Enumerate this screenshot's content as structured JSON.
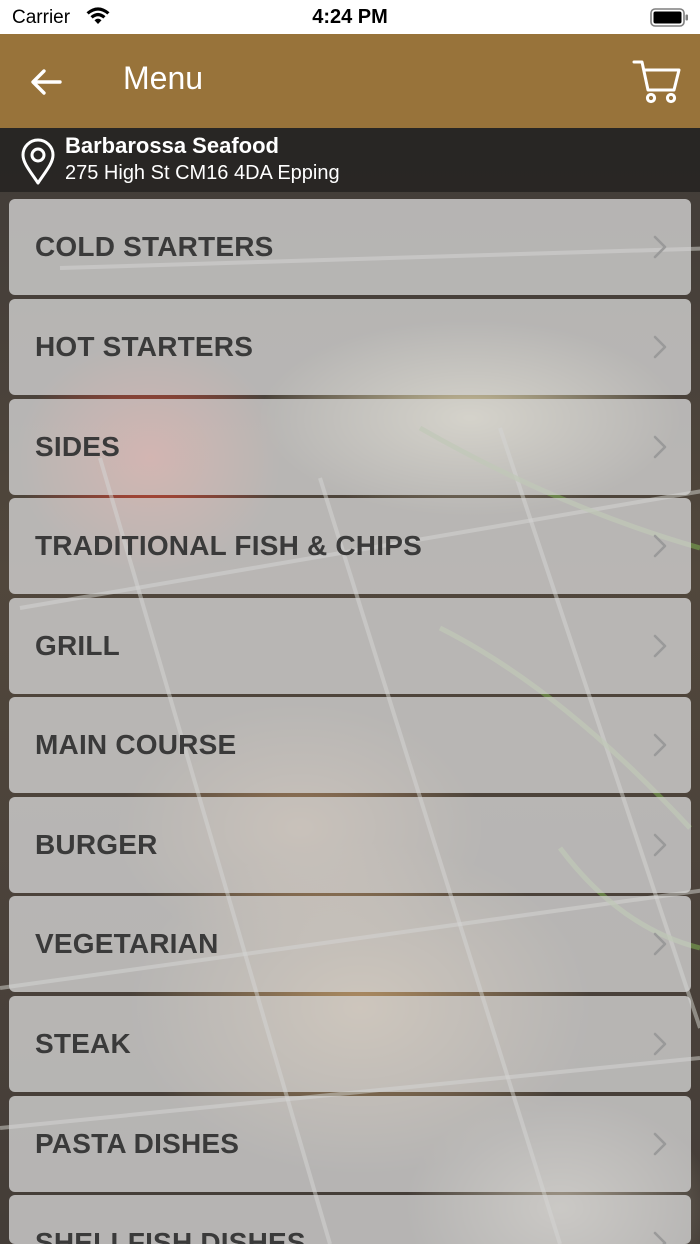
{
  "status_bar": {
    "carrier": "Carrier",
    "time": "4:24 PM"
  },
  "navbar": {
    "title": "Menu",
    "back_icon": "arrow-left-icon",
    "cart_icon": "cart-icon",
    "background_color": "#98733a"
  },
  "location": {
    "name": "Barbarossa Seafood",
    "address": "275 High St CM16 4DA Epping",
    "icon": "location-pin-icon"
  },
  "menu": {
    "items": [
      {
        "label": "COLD STARTERS"
      },
      {
        "label": "HOT STARTERS"
      },
      {
        "label": "SIDES"
      },
      {
        "label": "TRADITIONAL FISH & CHIPS"
      },
      {
        "label": "GRILL"
      },
      {
        "label": "MAIN COURSE"
      },
      {
        "label": "BURGER"
      },
      {
        "label": "VEGETARIAN"
      },
      {
        "label": "STEAK"
      },
      {
        "label": "PASTA DISHES"
      },
      {
        "label": "SHELLFISH DISHES"
      }
    ],
    "chevron_icon": "chevron-right-icon"
  }
}
